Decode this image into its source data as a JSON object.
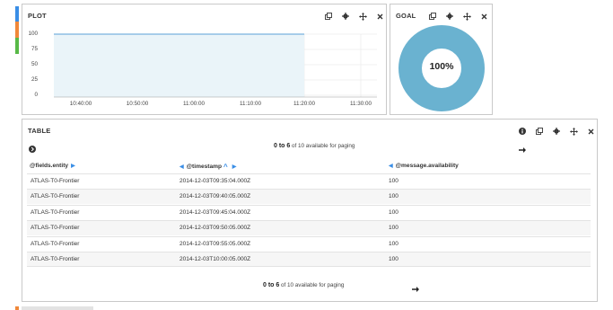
{
  "plot": {
    "title": "PLOT",
    "y_ticks": [
      "100",
      "75",
      "50",
      "25",
      "0"
    ],
    "x_ticks": [
      "10:40:00",
      "10:50:00",
      "11:00:00",
      "11:10:00",
      "11:20:00",
      "11:30:00"
    ],
    "line_color": "#5aa0d6",
    "fill_color": "#eaf4f9"
  },
  "goal": {
    "title": "GOAL",
    "value_label": "100%",
    "ring_color": "#6ab2d0",
    "fraction": 1.0
  },
  "table": {
    "title": "TABLE",
    "pager_top": {
      "range": "0 to 6",
      "rest": "of 10 available for paging"
    },
    "pager_bottom": {
      "range": "0 to 6",
      "rest": "of 10 available for paging"
    },
    "columns": [
      "@fields.entity",
      "@timestamp",
      "@message.availability"
    ],
    "rows": [
      [
        "ATLAS-T0-Frontier",
        "2014-12-03T09:35:04.000Z",
        "100"
      ],
      [
        "ATLAS-T0-Frontier",
        "2014-12-03T09:40:05.000Z",
        "100"
      ],
      [
        "ATLAS-T0-Frontier",
        "2014-12-03T09:45:04.000Z",
        "100"
      ],
      [
        "ATLAS-T0-Frontier",
        "2014-12-03T09:50:05.000Z",
        "100"
      ],
      [
        "ATLAS-T0-Frontier",
        "2014-12-03T09:55:05.000Z",
        "100"
      ],
      [
        "ATLAS-T0-Frontier",
        "2014-12-03T10:00:05.000Z",
        "100"
      ]
    ]
  },
  "row_colors": [
    "#3a8ee6",
    "#f0883a",
    "#58b947",
    "#f0883a"
  ]
}
